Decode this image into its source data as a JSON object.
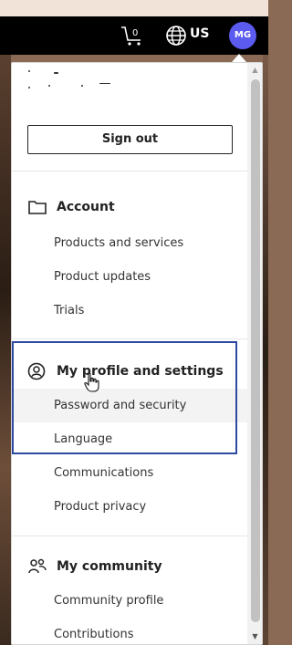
{
  "header": {
    "cart_count": "0",
    "region": "US",
    "avatar_initials": "MG"
  },
  "menu": {
    "sign_out_label": "Sign out",
    "sections": [
      {
        "title": "Account",
        "icon": "folder-icon",
        "items": [
          "Products and services",
          "Product updates",
          "Trials"
        ]
      },
      {
        "title": "My profile and settings",
        "icon": "user-circle-icon",
        "items": [
          "Password and security",
          "Language",
          "Communications",
          "Product privacy"
        ]
      },
      {
        "title": "My community",
        "icon": "community-icon",
        "items": [
          "Community profile",
          "Contributions"
        ]
      }
    ]
  },
  "colors": {
    "avatar_bg": "#5b5bf0",
    "highlight_box": "#2d4aa0"
  }
}
